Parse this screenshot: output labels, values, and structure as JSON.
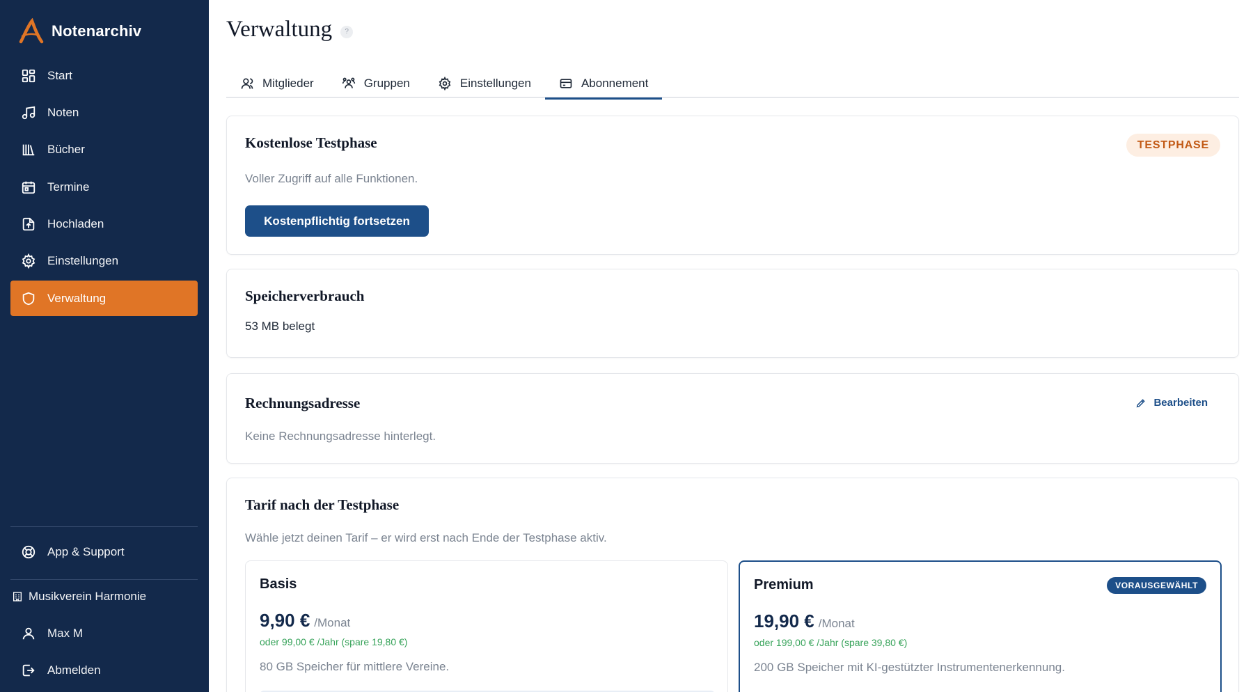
{
  "brand": {
    "name": "Notenarchiv",
    "accent": "#e07526",
    "sidebar_bg": "#13294b"
  },
  "sidebar": {
    "items": [
      {
        "label": "Start",
        "icon": "grid-icon"
      },
      {
        "label": "Noten",
        "icon": "music-note-icon"
      },
      {
        "label": "Bücher",
        "icon": "library-icon"
      },
      {
        "label": "Termine",
        "icon": "calendar-icon"
      },
      {
        "label": "Hochladen",
        "icon": "file-upload-icon"
      },
      {
        "label": "Einstellungen",
        "icon": "gear-icon"
      },
      {
        "label": "Verwaltung",
        "icon": "shield-icon",
        "active": true
      }
    ],
    "support": "App & Support",
    "organization": "Musikverein Harmonie",
    "user": "Max M",
    "logout": "Abmelden"
  },
  "page": {
    "title": "Verwaltung",
    "help": "?"
  },
  "tabs": [
    {
      "label": "Mitglieder",
      "icon": "users-icon"
    },
    {
      "label": "Gruppen",
      "icon": "group-icon"
    },
    {
      "label": "Einstellungen",
      "icon": "gear-icon"
    },
    {
      "label": "Abonnement",
      "icon": "credit-card-icon",
      "active": true
    }
  ],
  "trial": {
    "title": "Kostenlose Testphase",
    "badge": "TESTPHASE",
    "description": "Voller Zugriff auf alle Funktionen.",
    "button": "Kostenpflichtig fortsetzen"
  },
  "storage": {
    "title": "Speicherverbrauch",
    "value": "53 MB belegt"
  },
  "billing": {
    "title": "Rechnungsadresse",
    "edit": "Bearbeiten",
    "empty": "Keine Rechnungsadresse hinterlegt."
  },
  "tariff": {
    "title": "Tarif nach der Testphase",
    "description": "Wähle jetzt deinen Tarif – er wird erst nach Ende der Testphase aktiv.",
    "plans": [
      {
        "name": "Basis",
        "price": "9,90 €",
        "unit": "/Monat",
        "yearly": "oder 99,00 € /Jahr (spare 19,80 €)",
        "description": "80 GB Speicher für mittlere Vereine."
      },
      {
        "name": "Premium",
        "price": "19,90 €",
        "unit": "/Monat",
        "yearly": "oder 199,00 € /Jahr (spare 39,80 €)",
        "description": "200 GB Speicher mit KI-gestützter Instrumentenerkennung.",
        "badge": "VORAUSGEWÄHLT",
        "selected": true
      }
    ]
  }
}
